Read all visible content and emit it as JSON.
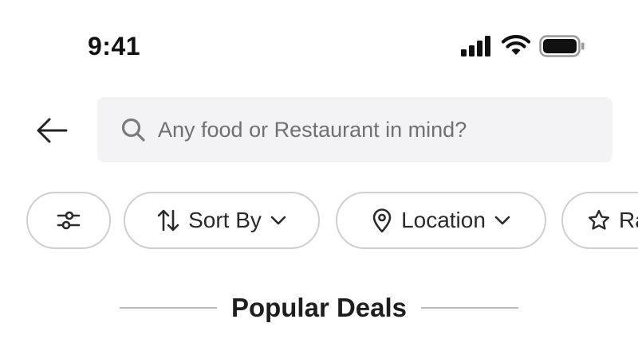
{
  "status_bar": {
    "time": "9:41",
    "icons": [
      "cellular-signal-icon",
      "wifi-icon",
      "battery-icon"
    ]
  },
  "header": {
    "back_icon": "arrow-left-icon",
    "search": {
      "placeholder": "Any food or Restaurant in mind?",
      "value": "",
      "icon": "search-icon"
    }
  },
  "filters": {
    "items": [
      {
        "id": "filter",
        "label": "",
        "icon": "sliders-icon"
      },
      {
        "id": "sort",
        "label": "Sort By",
        "icon": "sort-arrows-icon",
        "trailing_icon": "chevron-down-icon"
      },
      {
        "id": "location",
        "label": "Location",
        "icon": "map-pin-icon",
        "trailing_icon": "chevron-down-icon"
      },
      {
        "id": "rating",
        "label": "Ra",
        "icon": "star-icon"
      }
    ]
  },
  "section": {
    "title": "Popular Deals"
  },
  "colors": {
    "background": "#ffffff",
    "search_background": "#f3f3f6",
    "chip_border": "#cfcfcf",
    "text_primary": "#1e1e1e",
    "placeholder": "#6f6f74"
  }
}
